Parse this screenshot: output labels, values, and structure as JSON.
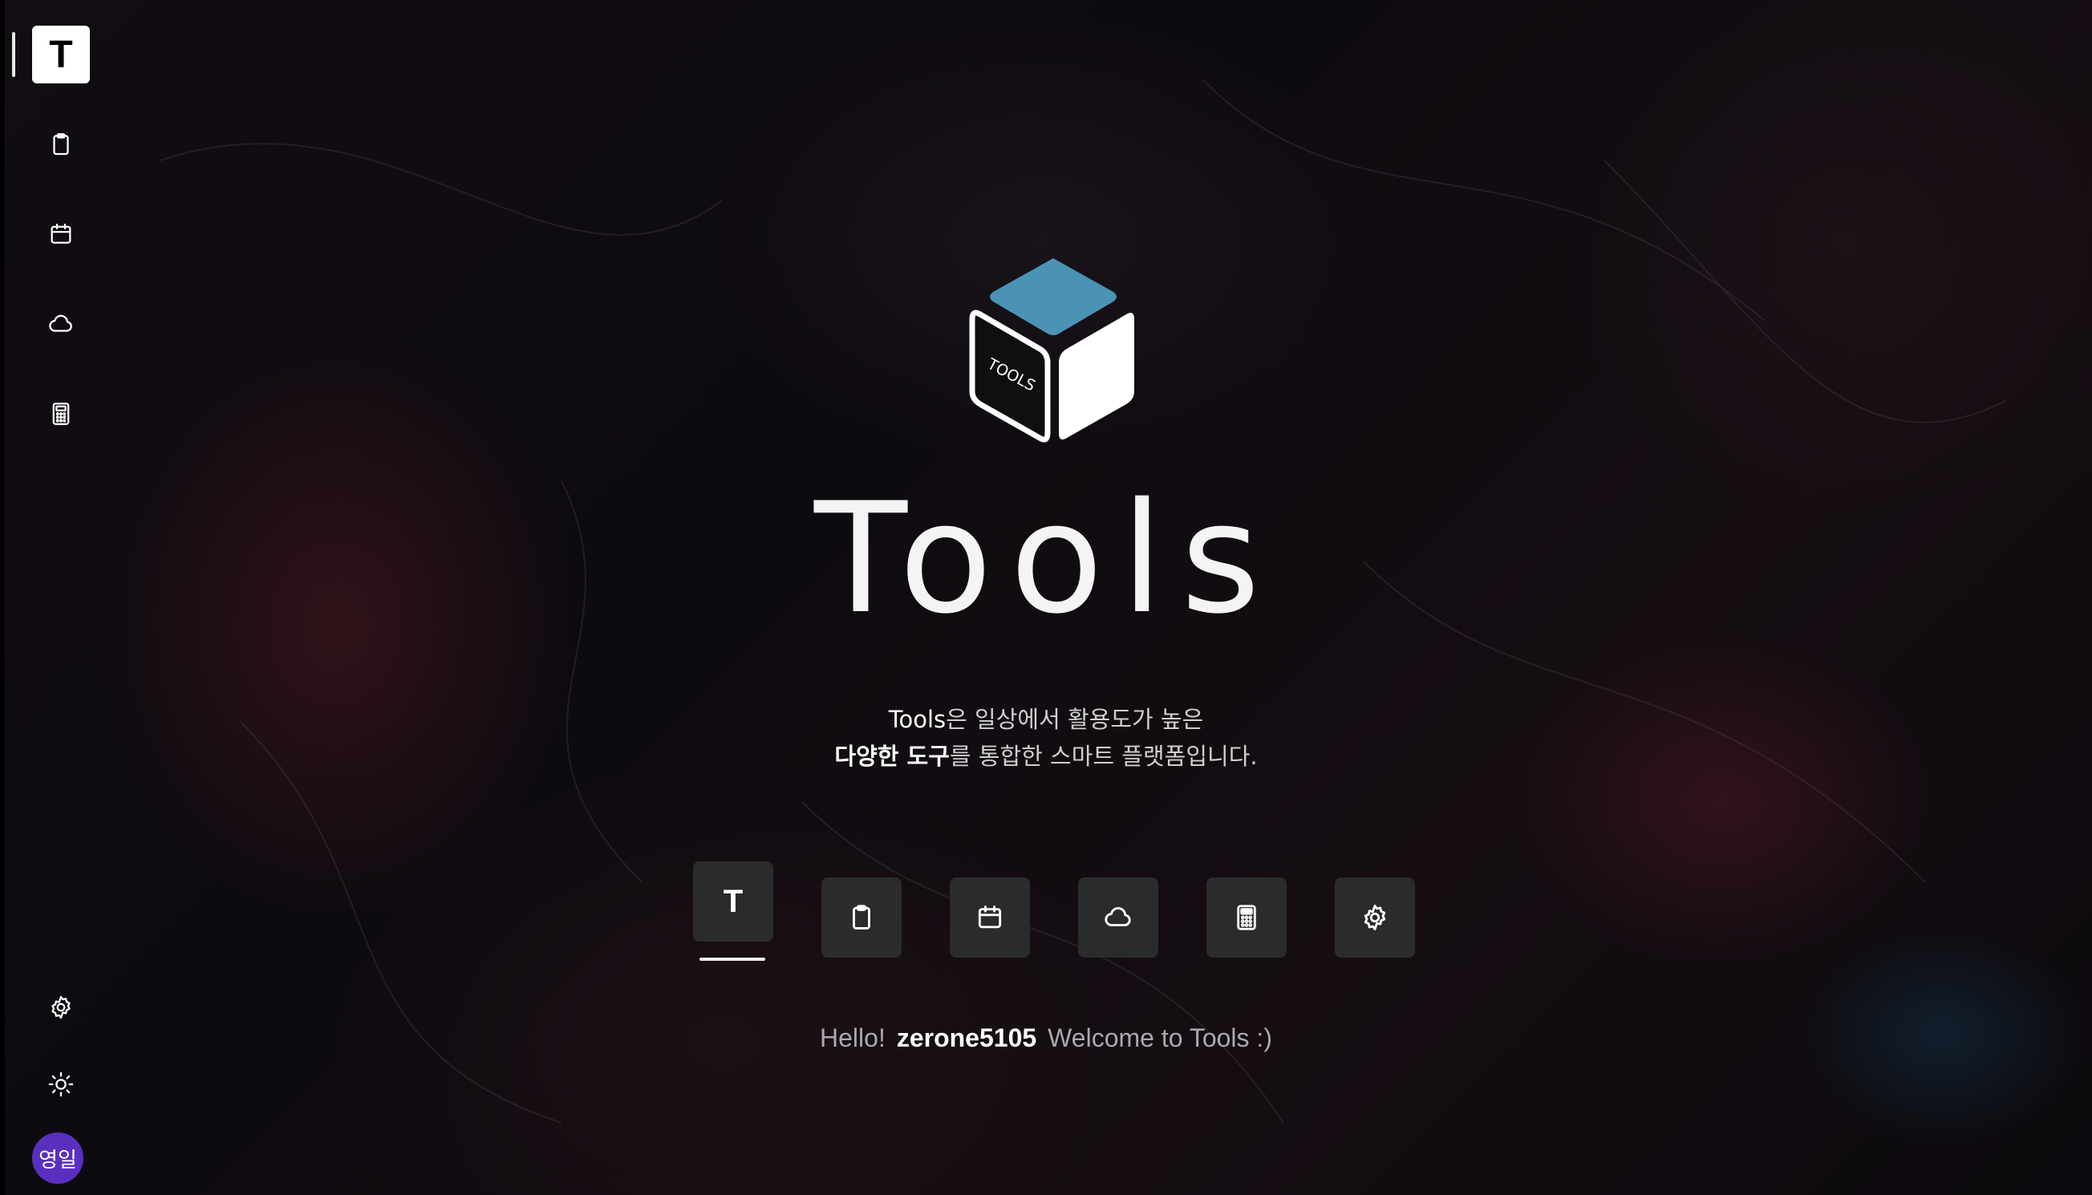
{
  "sidebar": {
    "logo_letter": "T",
    "items": [
      {
        "name": "clipboard-icon"
      },
      {
        "name": "calendar-icon"
      },
      {
        "name": "cloud-icon"
      },
      {
        "name": "calculator-icon"
      }
    ],
    "bottom": [
      {
        "name": "gear-icon"
      },
      {
        "name": "sun-icon"
      }
    ],
    "avatar_text": "영일",
    "avatar_color": "#5a2fc0"
  },
  "hero": {
    "cube_label": "TOOLS",
    "cube_top_color": "#4a93b5",
    "title": "Tools",
    "desc_line1_strong": "Tools",
    "desc_line1_rest": "은 일상에서 활용도가 높은",
    "desc_line2_strong": "다양한 도구",
    "desc_line2_rest": "를 통합한 스마트 플랫폼입니다."
  },
  "tools": {
    "home_letter": "T",
    "items": [
      "home",
      "clipboard-icon",
      "calendar-icon",
      "cloud-icon",
      "calculator-icon",
      "gear-icon"
    ]
  },
  "greeting": {
    "hello": "Hello!",
    "username": "zerone5105",
    "welcome": "Welcome to Tools :)"
  }
}
